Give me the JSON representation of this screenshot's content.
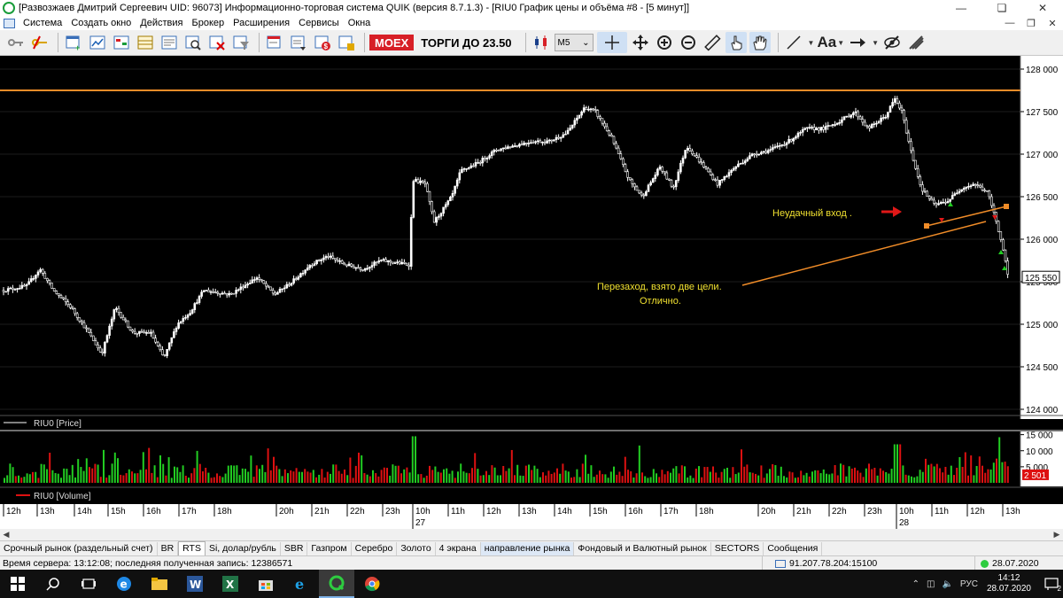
{
  "window": {
    "title": "[Развозжаев Дмитрий Сергеевич UID: 96073] Информационно-торговая система QUIK (версия 8.7.1.3) - [RIU0 График цены и объёма #8 - [5 минут]]"
  },
  "menu": {
    "items": [
      "Система",
      "Создать окно",
      "Действия",
      "Брокер",
      "Расширения",
      "Сервисы",
      "Окна"
    ]
  },
  "toolbar": {
    "moex_label": "MOEX",
    "trading_until": "ТОРГИ ДО 23.50",
    "timeframe": "M5",
    "text_tool_label": "Aa"
  },
  "chart": {
    "price_panel_label": "RIU0 [Price]",
    "volume_panel_label": "RIU0 [Volume]",
    "price_ticks": [
      "128 000",
      "127 500",
      "127 000",
      "126 500",
      "126 000",
      "125 500",
      "125 000",
      "124 500",
      "124 000"
    ],
    "last_price": "125 550",
    "volume_ticks": [
      "15 000",
      "10 000",
      "5 000"
    ],
    "last_volume": "2 501",
    "time_labels": [
      "12h",
      "13h",
      "14h",
      "15h",
      "16h",
      "17h",
      "18h",
      "20h",
      "21h",
      "22h",
      "23h",
      "10h",
      "11h",
      "12h",
      "13h",
      "14h",
      "15h",
      "16h",
      "17h",
      "18h",
      "20h",
      "21h",
      "22h",
      "23h",
      "10h",
      "11h",
      "12h",
      "13h"
    ],
    "date_labels": [
      "27",
      "28"
    ],
    "annotation_fail": "Неудачный вход .",
    "annotation_reentry_1": "Перезаход, взято две цели.",
    "annotation_reentry_2": "Отлично.",
    "colors": {
      "background": "#000000",
      "candles": "#ffffff",
      "volume_up": "#22cc22",
      "volume_down": "#dd1111",
      "resistance_line": "#f08c28",
      "annotation_text": "#f0e030",
      "arrow": "#e01818"
    }
  },
  "tabs": [
    {
      "label": "Срочный рынок (раздельный счет)"
    },
    {
      "label": "BR"
    },
    {
      "label": "RTS",
      "active": true
    },
    {
      "label": "Si, долар/рубль"
    },
    {
      "label": "SBR"
    },
    {
      "label": "Газпром"
    },
    {
      "label": "Серебро"
    },
    {
      "label": "Золото"
    },
    {
      "label": "4 экрана"
    },
    {
      "label": "направление рынка",
      "highlight": true
    },
    {
      "label": "Фондовый и Валютный рынок"
    },
    {
      "label": "SECTORS"
    },
    {
      "label": "Сообщения"
    }
  ],
  "status": {
    "server_time": "Время сервера: 13:12:08; последняя полученная запись: 12386571",
    "connection": "91.207.78.204:15100",
    "date": "28.07.2020"
  },
  "taskbar": {
    "time": "14:12",
    "date": "28.07.2020",
    "language": "РУС",
    "notifications": "2"
  }
}
